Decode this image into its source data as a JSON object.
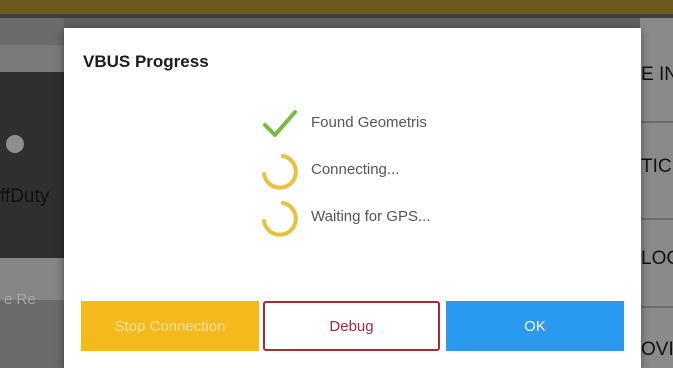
{
  "background": {
    "left_label": "ffDuty",
    "left_muted_label": "e Re",
    "right_labels": [
      "E IN",
      "TIC",
      "LOG",
      "OVI"
    ]
  },
  "dialog": {
    "title": "VBUS Progress",
    "statuses": [
      {
        "icon": "checkmark-icon",
        "text": "Found Geometris",
        "state": "done"
      },
      {
        "icon": "spinner-icon",
        "text": "Connecting...",
        "state": "in-progress"
      },
      {
        "icon": "spinner-icon",
        "text": "Waiting for GPS...",
        "state": "in-progress"
      }
    ],
    "buttons": {
      "stop": "Stop Connection",
      "debug": "Debug",
      "ok": "OK"
    }
  },
  "colors": {
    "accent_yellow": "#f6b91c",
    "check_green": "#6fbf3c",
    "debug_red": "#a42a3e",
    "ok_blue": "#2a9af0",
    "spinner_yellow": "#e8c23a"
  }
}
